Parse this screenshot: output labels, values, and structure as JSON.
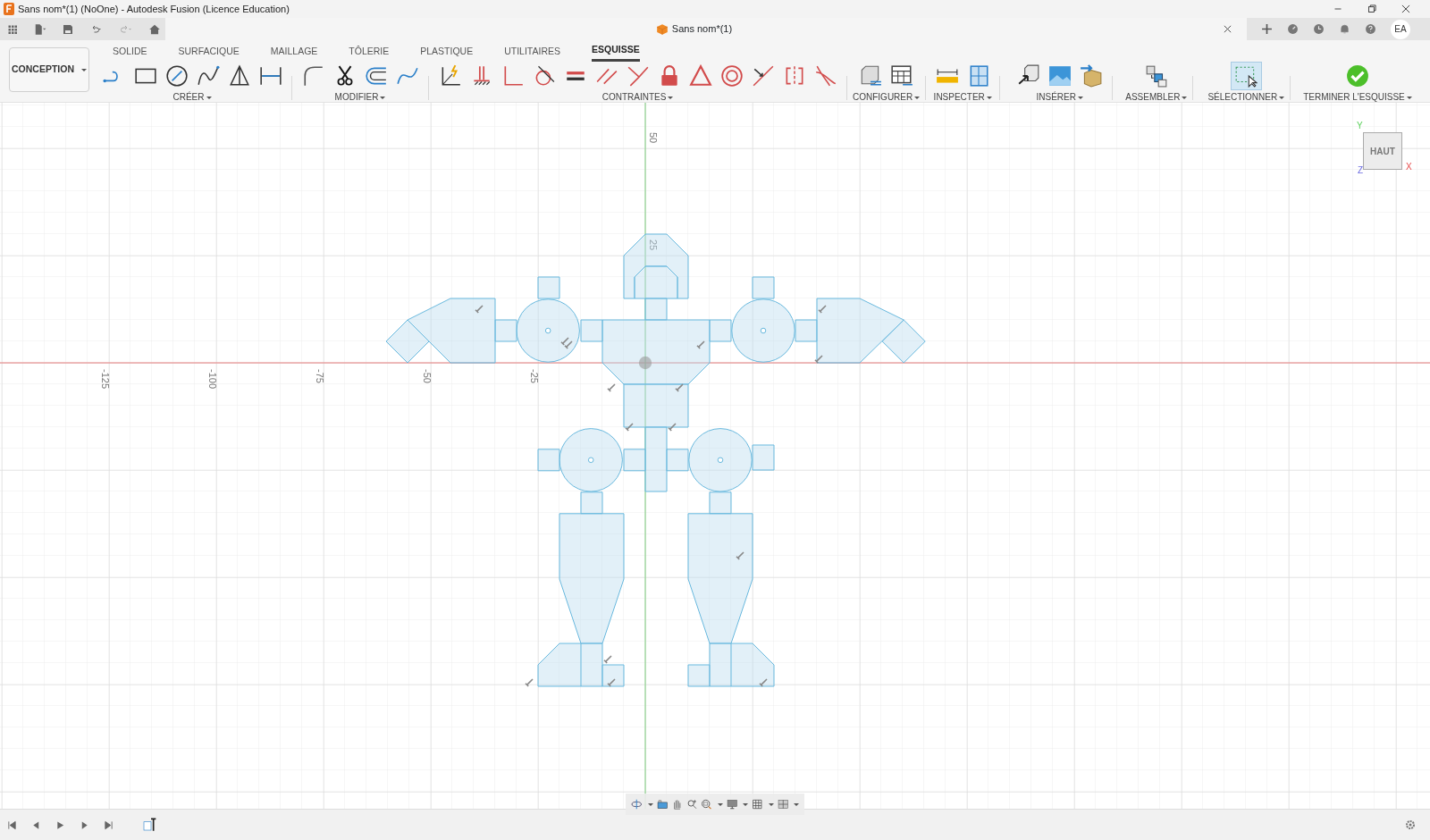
{
  "window": {
    "title": "Sans nom*(1) (NoOne) - Autodesk Fusion (Licence Education)"
  },
  "document_tab": {
    "title": "Sans nom*(1)"
  },
  "user": {
    "initials": "EA"
  },
  "workspace": {
    "label": "CONCEPTION"
  },
  "tabs": [
    {
      "label": "SOLIDE",
      "selected": false
    },
    {
      "label": "SURFACIQUE",
      "selected": false
    },
    {
      "label": "MAILLAGE",
      "selected": false
    },
    {
      "label": "TÔLERIE",
      "selected": false
    },
    {
      "label": "PLASTIQUE",
      "selected": false
    },
    {
      "label": "UTILITAIRES",
      "selected": false
    },
    {
      "label": "ESQUISSE",
      "selected": true
    }
  ],
  "groups": [
    {
      "label": "CRÉER",
      "kind": "create"
    },
    {
      "label": "MODIFIER",
      "kind": "modify"
    },
    {
      "label": "CONTRAINTES",
      "kind": "constraints"
    },
    {
      "label": "CONFIGURER",
      "kind": "configure"
    },
    {
      "label": "INSPECTER",
      "kind": "inspect"
    },
    {
      "label": "INSÉRER",
      "kind": "insert"
    },
    {
      "label": "ASSEMBLER",
      "kind": "assemble"
    },
    {
      "label": "SÉLECTIONNER",
      "kind": "select"
    },
    {
      "label": "TERMINER L'ESQUISSE",
      "kind": "finish"
    }
  ],
  "canvas": {
    "x_axis_labels": [
      "-125",
      "-100",
      "-75",
      "-50",
      "-25"
    ],
    "y_axis_labels": [
      "50",
      "25"
    ]
  },
  "view_cube": {
    "face": "HAUT",
    "axes": [
      "Y",
      "X",
      "Z"
    ]
  }
}
